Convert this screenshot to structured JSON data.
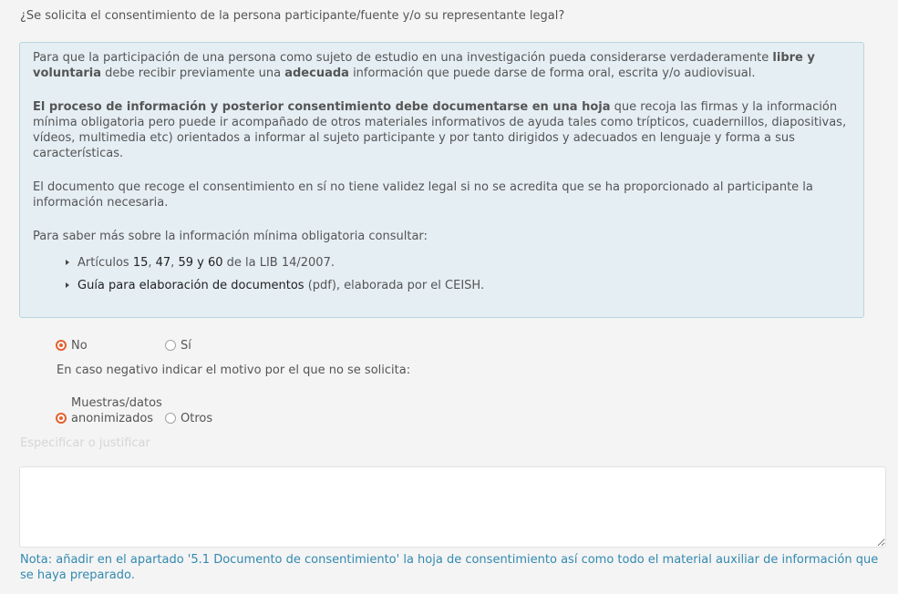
{
  "question": "¿Se solicita el consentimiento de la persona participante/fuente y/o su representante legal?",
  "info_box": {
    "p1": {
      "t1": "Para que la participación de una persona como sujeto de estudio en una investigación pueda considerarse verdaderamente ",
      "b1": "libre y voluntaria",
      "t2": " debe recibir previamente una ",
      "b2": "adecuada",
      "t3": " información que puede darse de forma oral, escrita y/o audiovisual."
    },
    "p2": {
      "b1": "El proceso de información y posterior consentimiento debe documentarse en una hoja",
      "t1": " que recoja las firmas y la información mínima obligatoria pero puede ir acompañado de otros materiales informativos de ayuda tales como trípticos, cuadernillos, diapositivas, vídeos, multimedia etc) orientados a informar al sujeto participante y por tanto dirigidos y adecuados en lenguaje y forma a sus características."
    },
    "p3": "El documento que recoge el consentimiento en sí no tiene validez legal si no se acredita que se ha proporcionado al participante la información necesaria.",
    "p4": "Para saber más sobre la información mínima obligatoria consultar:",
    "list_bullet_icon": "caret-right-icon",
    "references": [
      {
        "t1": "Artículos ",
        "l1": "15",
        "s1": ", ",
        "l2": "47",
        "s2": ", ",
        "l3": "59 y 60",
        "t2": " de la LIB 14/2007."
      },
      {
        "l1": "Guía para elaboración de documentos",
        "t1": " (pdf), elaborada por el CEISH."
      }
    ]
  },
  "consent": {
    "options": [
      {
        "label": "No",
        "checked": true
      },
      {
        "label": "Sí",
        "checked": false
      }
    ]
  },
  "reason_prompt": "En caso negativo indicar el motivo por el que no se solicita:",
  "reason": {
    "options": [
      {
        "label": "Muestras/datos anonimizados",
        "checked": true
      },
      {
        "label": "Otros",
        "checked": false
      }
    ]
  },
  "justification": {
    "label": "Especificar o justificar",
    "value": ""
  },
  "note": "Nota: añadir en el apartado '5.1 Documento de consentimiento' la hoja de consentimiento así como todo el material auxiliar de información que se haya preparado.",
  "colors": {
    "accent": "#e4602f",
    "page_bg": "#f4f4f4",
    "text": "#555555",
    "link": "#222222",
    "info_bg": "#e4eef3",
    "info_border": "#b9d6df",
    "note": "#3389b0",
    "muted_label": "#d6d6d6"
  }
}
